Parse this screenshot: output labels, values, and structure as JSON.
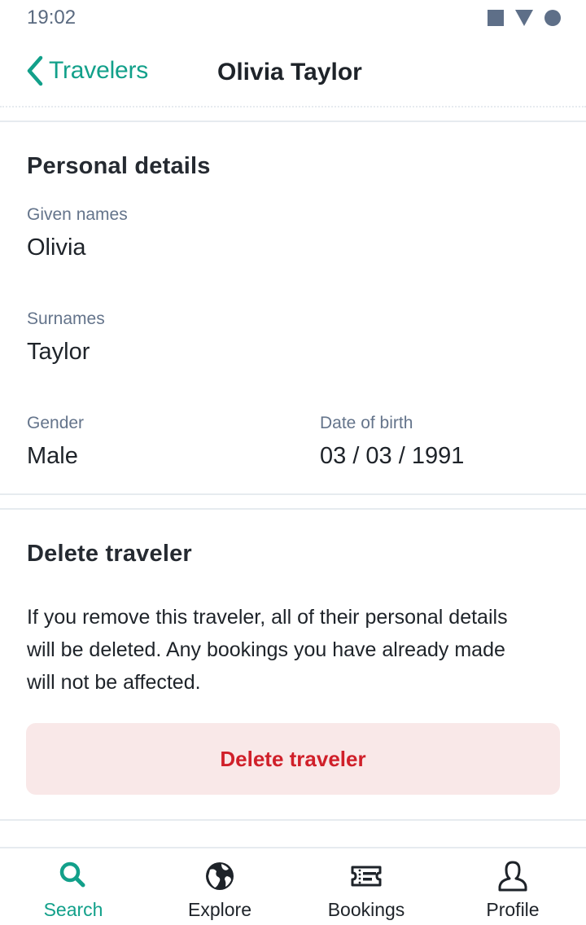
{
  "status_bar": {
    "time": "19:02",
    "icons": [
      "square-icon",
      "triangle-icon",
      "circle-icon"
    ]
  },
  "header": {
    "back_label": "Travelers",
    "back_icon": "chevron-left-icon",
    "title": "Olivia Taylor"
  },
  "personal_details": {
    "heading": "Personal details",
    "given_names": {
      "label": "Given names",
      "value": "Olivia"
    },
    "surnames": {
      "label": "Surnames",
      "value": "Taylor"
    },
    "gender": {
      "label": "Gender",
      "value": "Male"
    },
    "date_of_birth": {
      "label": "Date of birth",
      "value": "03 / 03 / 1991"
    }
  },
  "delete_section": {
    "heading": "Delete traveler",
    "description": "If you remove this traveler, all of their personal details will be deleted. Any bookings you have already made will not be affected.",
    "button_label": "Delete traveler"
  },
  "bottom_nav": {
    "items": [
      {
        "label": "Search",
        "icon": "search-icon",
        "active": true
      },
      {
        "label": "Explore",
        "icon": "globe-icon",
        "active": false
      },
      {
        "label": "Bookings",
        "icon": "ticket-icon",
        "active": false
      },
      {
        "label": "Profile",
        "icon": "user-icon",
        "active": false
      }
    ]
  },
  "colors": {
    "accent": "#12a08a",
    "danger": "#d0202a",
    "danger_bg": "#f9e8e8",
    "muted_text": "#64748b",
    "text": "#1e2329",
    "divider": "#e6ebef"
  }
}
